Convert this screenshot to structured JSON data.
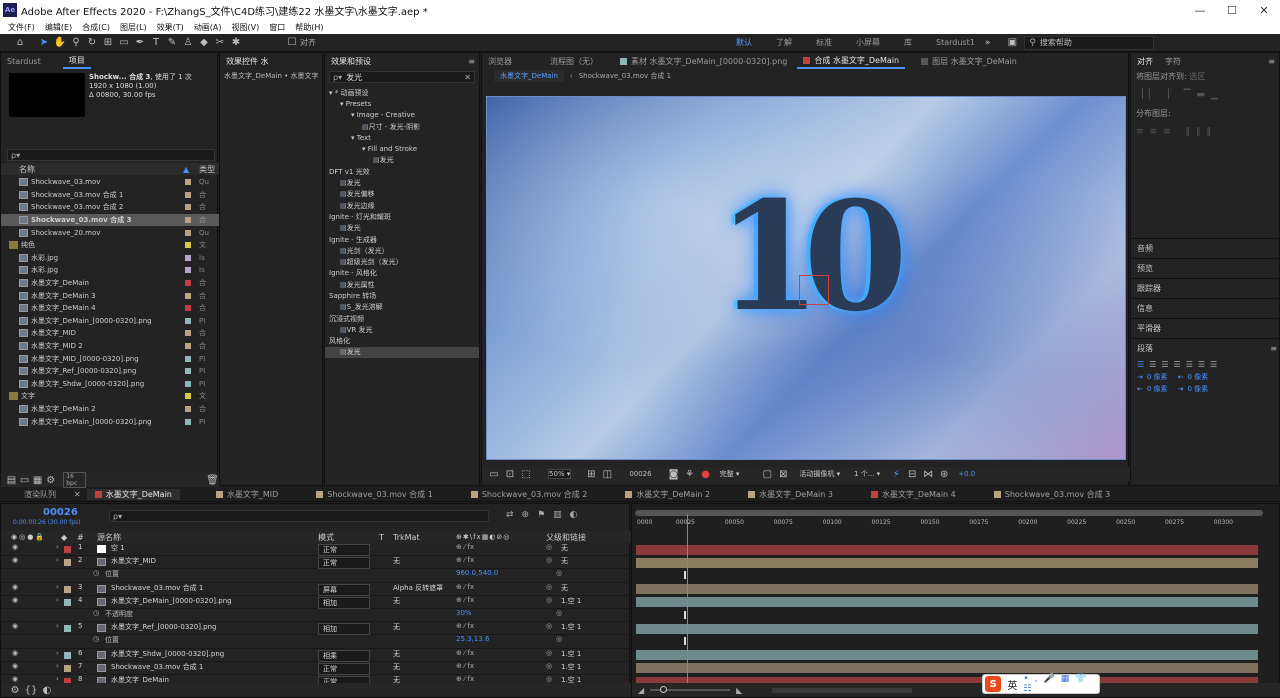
{
  "titlebar": {
    "app": "Ae",
    "title": "Adobe After Effects 2020 - F:\\ZhangS_文件\\C4D练习\\建练22 水墨文字\\水墨文字.aep *",
    "min": "—",
    "max": "☐",
    "close": "✕"
  },
  "menu": [
    "文件(F)",
    "编辑(E)",
    "合成(C)",
    "图层(L)",
    "效果(T)",
    "动画(A)",
    "视图(V)",
    "窗口",
    "帮助(H)"
  ],
  "toolbar": {
    "align_label": "对齐",
    "workspaces": [
      "默认",
      "了解",
      "标准",
      "小屏幕",
      "库",
      "Stardust1"
    ],
    "search_placeholder": "搜索帮助",
    "more": "»"
  },
  "project": {
    "tab_stardust": "Stardust",
    "tab_project": "项目",
    "selected_name": "Shockw...  合成 3",
    "selected_used": ", 使用了 1 次",
    "selected_dims": "1920 x 1080 (1.00)",
    "selected_duration": "Δ 00800, 30.00 fps",
    "col_name": "名称",
    "col_type": "类型",
    "bpc": "16 bpc",
    "items": [
      {
        "name": "Shockwave_03.mov",
        "type": "Qu",
        "tag": "#b8a480",
        "sel": false
      },
      {
        "name": "Shockwave_03.mov 合成 1",
        "type": "合",
        "tag": "#b8a480",
        "sel": false
      },
      {
        "name": "Shockwave_03.mov 合成 2",
        "type": "合",
        "tag": "#b8a480",
        "sel": false
      },
      {
        "name": "Shockwave_03.mov 合成 3",
        "type": "合",
        "tag": "#b8a480",
        "sel": true
      },
      {
        "name": "Shockwave_20.mov",
        "type": "Qu",
        "tag": "#b8a480",
        "sel": false
      },
      {
        "name": "纯色",
        "type": "文",
        "tag": "#d8c84a",
        "sel": false
      },
      {
        "name": "水彩.jpg",
        "type": "Is",
        "tag": "#b5a7c9",
        "sel": false
      },
      {
        "name": "水彩.jpg",
        "type": "Is",
        "tag": "#b5a7c9",
        "sel": false
      },
      {
        "name": "水墨文字_DeMain",
        "type": "合",
        "tag": "#c04040",
        "sel": false
      },
      {
        "name": "水墨文字_DeMain 3",
        "type": "合",
        "tag": "#b8a480",
        "sel": false
      },
      {
        "name": "水墨文字_DeMain 4",
        "type": "合",
        "tag": "#c04040",
        "sel": false
      },
      {
        "name": "水墨文字_DeMain_[0000-0320].png",
        "type": "PI",
        "tag": "#8fb8b8",
        "sel": false
      },
      {
        "name": "水墨文字_MID",
        "type": "合",
        "tag": "#b8a480",
        "sel": false
      },
      {
        "name": "水墨文字_MID 2",
        "type": "合",
        "tag": "#b8a480",
        "sel": false
      },
      {
        "name": "水墨文字_MID_[0000-0320].png",
        "type": "PI",
        "tag": "#8fb8b8",
        "sel": false
      },
      {
        "name": "水墨文字_Ref_[0000-0320].png",
        "type": "PI",
        "tag": "#8fb8b8",
        "sel": false
      },
      {
        "name": "水墨文字_Shdw_[0000-0320].png",
        "type": "PI",
        "tag": "#8fb8b8",
        "sel": false
      },
      {
        "name": "文字",
        "type": "文",
        "tag": "#d8c84a",
        "sel": false
      },
      {
        "name": "水墨文字_DeMain 2",
        "type": "合",
        "tag": "#b8a480",
        "sel": false
      },
      {
        "name": "水墨文字_DeMain_[0000-0320].png",
        "type": "PI",
        "tag": "#8fb8b8",
        "sel": false
      }
    ]
  },
  "effect_controls": {
    "tab": "效果控件 水",
    "layer": "水墨文字_DeMain • 水墨文字"
  },
  "effects": {
    "tab": "效果和预设",
    "search": "发光",
    "items": [
      {
        "t": "▾ * 动画预设",
        "d": 0
      },
      {
        "t": "▾ Presets",
        "d": 1
      },
      {
        "t": "▾ Image - Creative",
        "d": 2
      },
      {
        "t": "尺寸 - 发光-阴影",
        "d": 3
      },
      {
        "t": "▾ Text",
        "d": 2
      },
      {
        "t": "▾ Fill and Stroke",
        "d": 3
      },
      {
        "t": "发光",
        "d": 4
      },
      {
        "t": "DFT v1 光效",
        "d": 0
      },
      {
        "t": "发光",
        "d": 1
      },
      {
        "t": "发光偏移",
        "d": 1
      },
      {
        "t": "发光边缘",
        "d": 1
      },
      {
        "t": "Ignite - 灯光和耀斑",
        "d": 0
      },
      {
        "t": "发光",
        "d": 1
      },
      {
        "t": "Ignite - 生成器",
        "d": 0
      },
      {
        "t": "光剑（发光）",
        "d": 1
      },
      {
        "t": "超级光剑（发光）",
        "d": 1
      },
      {
        "t": "Ignite - 风格化",
        "d": 0
      },
      {
        "t": "发光属性",
        "d": 1
      },
      {
        "t": "Sapphire 转场",
        "d": 0
      },
      {
        "t": "S_发光溶解",
        "d": 1
      },
      {
        "t": "沉浸式视频",
        "d": 0
      },
      {
        "t": "VR 发光",
        "d": 1
      },
      {
        "t": "风格化",
        "d": 0
      },
      {
        "t": "发光",
        "d": 1
      }
    ]
  },
  "viewer": {
    "tab_browser": "浏览器",
    "tab_flow": "流程图（无）",
    "tab_footage": "素材 水墨文字_DeMain_[0000-0320].png",
    "tab_comp": "合成 水墨文字_DeMain",
    "tab_layer": "图层 水墨文字_DeMain",
    "crumb_active": "水墨文字_DeMain",
    "crumb_next": "Shockwave_03.mov 合成 1",
    "art_text": "10",
    "zoom": "50%",
    "frame": "00026",
    "quality": "完整",
    "camera": "活动摄像机",
    "views": "1 个...",
    "exposure": "+0.0"
  },
  "right": {
    "tab_align": "对齐",
    "tab_char": "字符",
    "align_to_label": "将图层对齐到:",
    "align_to_value": "选区",
    "distribute": "分布图层:",
    "panels": [
      "音频",
      "预览",
      "跟踪器",
      "信息",
      "平滑器"
    ],
    "para": "段落",
    "indent_val": "0 像素"
  },
  "timeline": {
    "tab_render": "渲染队列",
    "tabs": [
      {
        "n": "水墨文字_DeMain",
        "c": "#c04040",
        "on": true
      },
      {
        "n": "水墨文字_MID",
        "c": "#b8a480"
      },
      {
        "n": "Shockwave_03.mov 合成 1",
        "c": "#b8a480"
      },
      {
        "n": "Shockwave_03.mov 合成 2",
        "c": "#b8a480"
      },
      {
        "n": "水墨文字_DeMain 2",
        "c": "#b8a480"
      },
      {
        "n": "水墨文字_DeMain 3",
        "c": "#b8a480"
      },
      {
        "n": "水墨文字_DeMain 4",
        "c": "#c04040"
      },
      {
        "n": "Shockwave_03.mov 合成 3",
        "c": "#b8a480"
      }
    ],
    "timecode": "00026",
    "timecode_sub": "0:00:00:26 (30.00 fps)",
    "search_placeholder": "ρ▾",
    "col_src": "源名称",
    "col_mode": "模式",
    "col_t": "T",
    "col_trk": "TrkMat",
    "col_parent": "父级和链接",
    "ruler": [
      "0000",
      "00025",
      "00050",
      "00075",
      "00100",
      "00125",
      "00150",
      "00175",
      "00200",
      "00225",
      "00250",
      "00275",
      "00300"
    ],
    "layers": [
      {
        "num": "1",
        "name": "空 1",
        "mode": "正常",
        "trk": "",
        "par": "无",
        "tag": "#c04040",
        "bar": "#8a3a3a",
        "eye": "●",
        "prop": false
      },
      {
        "num": "2",
        "name": "水墨文字_MID",
        "mode": "正常",
        "trk": "无",
        "par": "无",
        "tag": "#b8a480",
        "bar": "#8a7d62",
        "eye": "●",
        "prop": false
      },
      {
        "num": "",
        "name": "位置",
        "mode": "",
        "trk": "",
        "par": "",
        "val": "960.0,540.0",
        "prop": true
      },
      {
        "num": "3",
        "name": "Shockwave_03.mov 合成 1",
        "mode": "屏幕",
        "trk": "Alpha 反转遮罩",
        "par": "无",
        "tag": "#b8a480",
        "bar": "#7d7260",
        "eye": "●",
        "prop": false
      },
      {
        "num": "4",
        "name": "水墨文字_DeMain_[0000-0320].png",
        "mode": "相加",
        "trk": "无",
        "par": "1.空 1",
        "tag": "#8fb8b8",
        "bar": "#6e8a8a",
        "eye": "●",
        "prop": false
      },
      {
        "num": "",
        "name": "不透明度",
        "mode": "",
        "trk": "",
        "par": "",
        "val": "30%",
        "prop": true
      },
      {
        "num": "5",
        "name": "水墨文字_Ref_[0000-0320].png",
        "mode": "相加",
        "trk": "无",
        "par": "1.空 1",
        "tag": "#8fb8b8",
        "bar": "#6e8a8a",
        "eye": "●",
        "prop": false
      },
      {
        "num": "",
        "name": "位置",
        "mode": "",
        "trk": "",
        "par": "",
        "val": "25.3,13.6",
        "prop": true
      },
      {
        "num": "6",
        "name": "水墨文字_Shdw_[0000-0320].png",
        "mode": "相乘",
        "trk": "无",
        "par": "1.空 1",
        "tag": "#8fb8b8",
        "bar": "#6e8a8a",
        "eye": "●",
        "prop": false
      },
      {
        "num": "7",
        "name": "Shockwave_03.mov 合成 1",
        "mode": "正常",
        "trk": "无",
        "par": "1.空 1",
        "tag": "#b8a480",
        "bar": "#7d7260",
        "eye": "●",
        "prop": false
      },
      {
        "num": "8",
        "name": "水墨文字_DeMain",
        "mode": "正常",
        "trk": "无",
        "par": "1.空 1",
        "tag": "#c04040",
        "bar": "#8a3a3a",
        "eye": "●",
        "prop": false
      }
    ],
    "frame_current": 26,
    "frame_total": 320
  },
  "ime": {
    "label": "英"
  },
  "colors": {
    "accent": "#4a90ff",
    "panel": "#232323",
    "bg": "#1d1d1d"
  }
}
